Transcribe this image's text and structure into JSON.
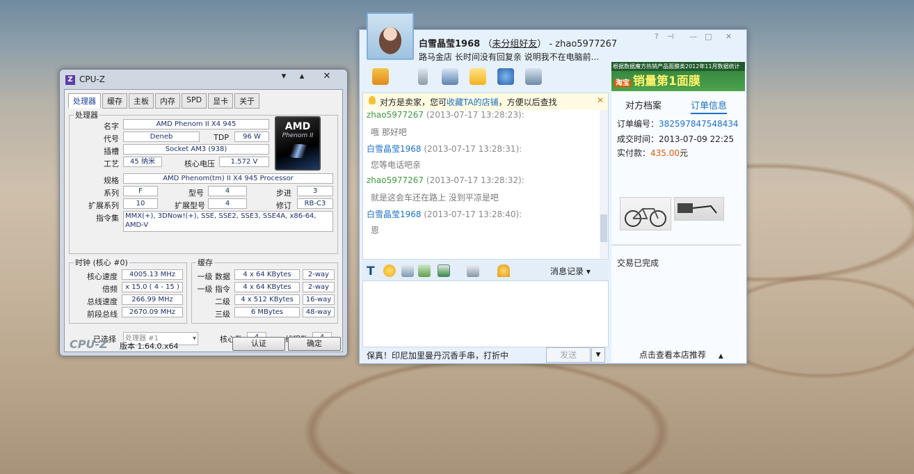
{
  "cpuz": {
    "title": "CPU-Z",
    "controls": [
      "▾",
      "▴",
      "✕"
    ],
    "tabs": [
      "处理器",
      "缓存",
      "主板",
      "内存",
      "SPD",
      "显卡",
      "关于"
    ],
    "processor": {
      "legend": "处理器",
      "name_l": "名字",
      "name": "AMD Phenom II X4 945",
      "code_l": "代号",
      "code": "Deneb",
      "tdp_l": "TDP",
      "tdp": "96 W",
      "socket_l": "插槽",
      "socket": "Socket AM3 (938)",
      "tech_l": "工艺",
      "tech": "45 纳米",
      "volt_l": "核心电压",
      "volt": "1.572 V",
      "spec_l": "规格",
      "spec": "AMD Phenom(tm) II X4 945 Processor",
      "family_l": "系列",
      "family": "F",
      "model_l": "型号",
      "model": "4",
      "step_l": "步进",
      "step": "3",
      "extfam_l": "扩展系列",
      "extfam": "10",
      "extmod_l": "扩展型号",
      "extmod": "4",
      "rev_l": "修订",
      "rev": "RB-C3",
      "instr_l": "指令集",
      "instr": "MMX(+), 3DNow!(+), SSE, SSE2, SSE3, SSE4A, x86-64, AMD-V",
      "logo_brand": "AMD",
      "logo_line": "Phenom II"
    },
    "clocks": {
      "legend": "时钟 (核心 #0)",
      "core_l": "核心速度",
      "core": "4005.13 MHz",
      "mult_l": "倍频",
      "mult": "x 15.0 ( 4 - 15 )",
      "bus_l": "总线速度",
      "bus": "266.99 MHz",
      "fsb_l": "前段总线",
      "fsb": "2670.09 MHz"
    },
    "cache": {
      "legend": "缓存",
      "rows": [
        {
          "l": "一级 数据",
          "v": "4 x 64 KBytes",
          "w": "2-way"
        },
        {
          "l": "一级 指令",
          "v": "4 x 64 KBytes",
          "w": "2-way"
        },
        {
          "l": "二级",
          "v": "4 x 512 KBytes",
          "w": "16-way"
        },
        {
          "l": "三级",
          "v": "6 MBytes",
          "w": "48-way"
        }
      ]
    },
    "sel": {
      "l": "已选择",
      "v": "处理器 #1",
      "cores_l": "核心数",
      "cores": "4",
      "threads_l": "线程数",
      "threads": "4"
    },
    "footer": {
      "brand": "CPU-Z",
      "version": "版本 1.64.0.x64",
      "verify": "认证",
      "ok": "确定"
    }
  },
  "ww": {
    "name": "白雪晶莹1968",
    "group": "未分组好友",
    "account": "- zhao5977267",
    "signature": "路马金店  长时间没有回复亲  说明我不在电脑前...",
    "notice_a": "对方是卖家，您可",
    "notice_link": "收藏TA的店铺",
    "notice_b": "，方便以后查找",
    "messages": [
      {
        "who": "zhao5977267",
        "time": "(2013-07-17 13:28:23):",
        "text": "哦 那好吧",
        "color": "#3c9a3c"
      },
      {
        "who": "白雪晶莹1968",
        "time": "(2013-07-17 13:28:31):",
        "text": "您等电话吧亲",
        "color": "#1a6fc8"
      },
      {
        "who": "zhao5977267",
        "time": "(2013-07-17 13:28:32):",
        "text": "就是这会车还在路上 没到平凉是吧",
        "color": "#3c9a3c"
      },
      {
        "who": "白雪晶莹1968",
        "time": "(2013-07-17 13:28:40):",
        "text": "恩",
        "color": "#1a6fc8"
      }
    ],
    "history": "消息记录",
    "footer_text": "保真！印尼加里曼丹沉香手串，打折中",
    "send": "发送",
    "banner_small": "根据数据魔方热销产品面膜类2012年11月数据统计",
    "banner_tag": "淘宝",
    "banner_big": "销量第1面膜",
    "tab1": "对方档案",
    "tab2": "订单信息",
    "order_no_l": "订单编号：",
    "order_no": "382597847548434",
    "deal_time_l": "成交时间：",
    "deal_time": "2013-07-09 22:25",
    "paid_l": "实付款：",
    "paid": "435.00",
    "paid_unit": "元",
    "status": "交易已完成",
    "recommend": "点击查看本店推荐"
  }
}
